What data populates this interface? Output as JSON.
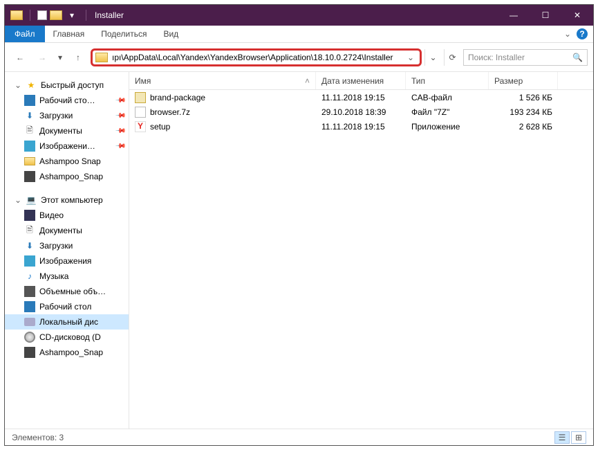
{
  "window": {
    "title": "Installer"
  },
  "tabs": {
    "file": "Файл",
    "home": "Главная",
    "share": "Поделиться",
    "view": "Вид"
  },
  "address": {
    "path": "ıpı\\AppData\\Local\\Yandex\\YandexBrowser\\Application\\18.10.0.2724\\Installer"
  },
  "search": {
    "placeholder": "Поиск: Installer"
  },
  "sidebar": {
    "quick_access": "Быстрый доступ",
    "qa_items": [
      {
        "label": "Рабочий сто…",
        "icon": "desktop",
        "pin": true
      },
      {
        "label": "Загрузки",
        "icon": "down",
        "pin": true
      },
      {
        "label": "Документы",
        "icon": "doc",
        "pin": true
      },
      {
        "label": "Изображени…",
        "icon": "pic",
        "pin": true
      },
      {
        "label": "Ashampoo Snap",
        "icon": "folder",
        "pin": false
      },
      {
        "label": "Ashampoo_Snap",
        "icon": "app",
        "pin": false
      }
    ],
    "this_pc": "Этот компьютер",
    "pc_items": [
      {
        "label": "Видео",
        "icon": "vid"
      },
      {
        "label": "Документы",
        "icon": "doc"
      },
      {
        "label": "Загрузки",
        "icon": "down"
      },
      {
        "label": "Изображения",
        "icon": "pic"
      },
      {
        "label": "Музыка",
        "icon": "mus"
      },
      {
        "label": "Объемные объ…",
        "icon": "vol"
      },
      {
        "label": "Рабочий стол",
        "icon": "desktop"
      },
      {
        "label": "Локальный дис",
        "icon": "disk",
        "selected": true
      },
      {
        "label": "CD-дисковод (D",
        "icon": "cd"
      },
      {
        "label": "Ashampoo_Snap",
        "icon": "app"
      }
    ]
  },
  "columns": {
    "name": "Имя",
    "date": "Дата изменения",
    "type": "Тип",
    "size": "Размер"
  },
  "files": [
    {
      "name": "brand-package",
      "date": "11.11.2018 19:15",
      "type": "CAB-файл",
      "size": "1 526 КБ",
      "icon": "box"
    },
    {
      "name": "browser.7z",
      "date": "29.10.2018 18:39",
      "type": "Файл \"7Z\"",
      "size": "193 234 КБ",
      "icon": "7z"
    },
    {
      "name": "setup",
      "date": "11.11.2018 19:15",
      "type": "Приложение",
      "size": "2 628 КБ",
      "icon": "y"
    }
  ],
  "status": {
    "count": "Элементов: 3"
  }
}
